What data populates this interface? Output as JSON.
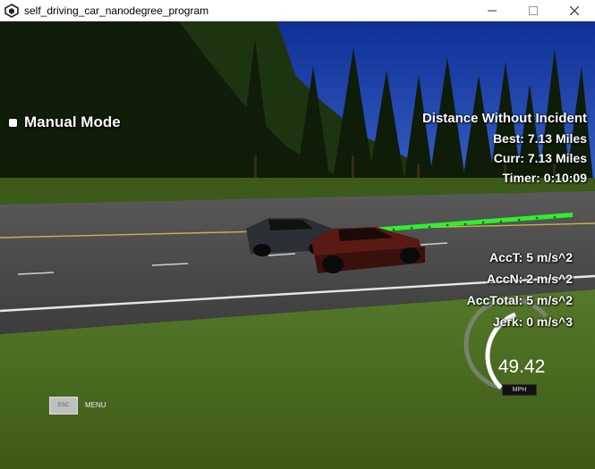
{
  "window": {
    "title": "self_driving_car_nanodegree_program",
    "app_icon": "unity-icon",
    "controls": [
      "minimize-icon",
      "maximize-icon",
      "close-icon"
    ]
  },
  "hud": {
    "mode": "Manual Mode",
    "distance_heading": "Distance Without Incident",
    "best": "Best: 7.13 Miles",
    "curr": "Curr: 7.13 Miles",
    "timer": "Timer: 0:10:09",
    "acc_t": "AccT: 5 m/s^2",
    "acc_n": "AccN: 2 m/s^2",
    "acc_total": "AccTotal: 5 m/s^2",
    "jerk": "Jerk: 0 m/s^3"
  },
  "speedometer": {
    "value": "49.42",
    "unit": "MPH",
    "fraction": 0.5
  },
  "menu": {
    "esc_label": "ESC",
    "menu_label": "MENU"
  },
  "colors": {
    "path": "#2ef02e",
    "sky": "#1c3fa8",
    "grass": "#4a6a1c",
    "road": "#4b4b4b"
  }
}
